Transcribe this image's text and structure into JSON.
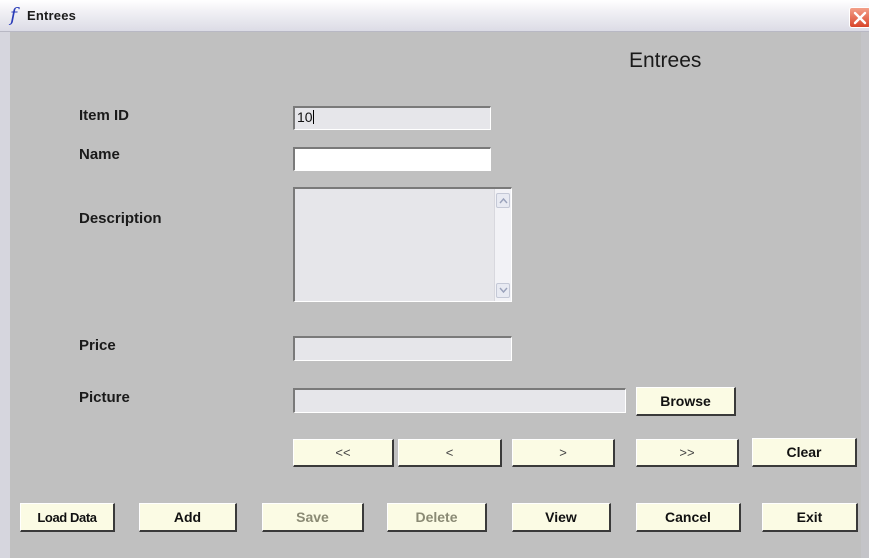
{
  "window": {
    "icon": "function-f-icon",
    "title": "Entrees",
    "close_icon": "close-icon"
  },
  "form": {
    "heading": "Entrees",
    "fields": {
      "item_id": {
        "label": "Item ID",
        "value": "10"
      },
      "name": {
        "label": "Name",
        "value": ""
      },
      "description": {
        "label": "Description",
        "value": ""
      },
      "price": {
        "label": "Price",
        "value": ""
      },
      "picture": {
        "label": "Picture",
        "value": ""
      }
    },
    "browse_label": "Browse"
  },
  "navigation": {
    "first": "<<",
    "prev": "<",
    "next": ">",
    "last": ">>",
    "clear": "Clear"
  },
  "actions": {
    "load_data": "Load Data",
    "add": "Add",
    "save": "Save",
    "delete": "Delete",
    "view": "View",
    "cancel": "Cancel",
    "exit": "Exit"
  },
  "colors": {
    "form_background": "#c0c0c0",
    "button_face": "#fbfbe4",
    "disabled_text": "#8a8a74",
    "close_button": "#d9452a"
  }
}
